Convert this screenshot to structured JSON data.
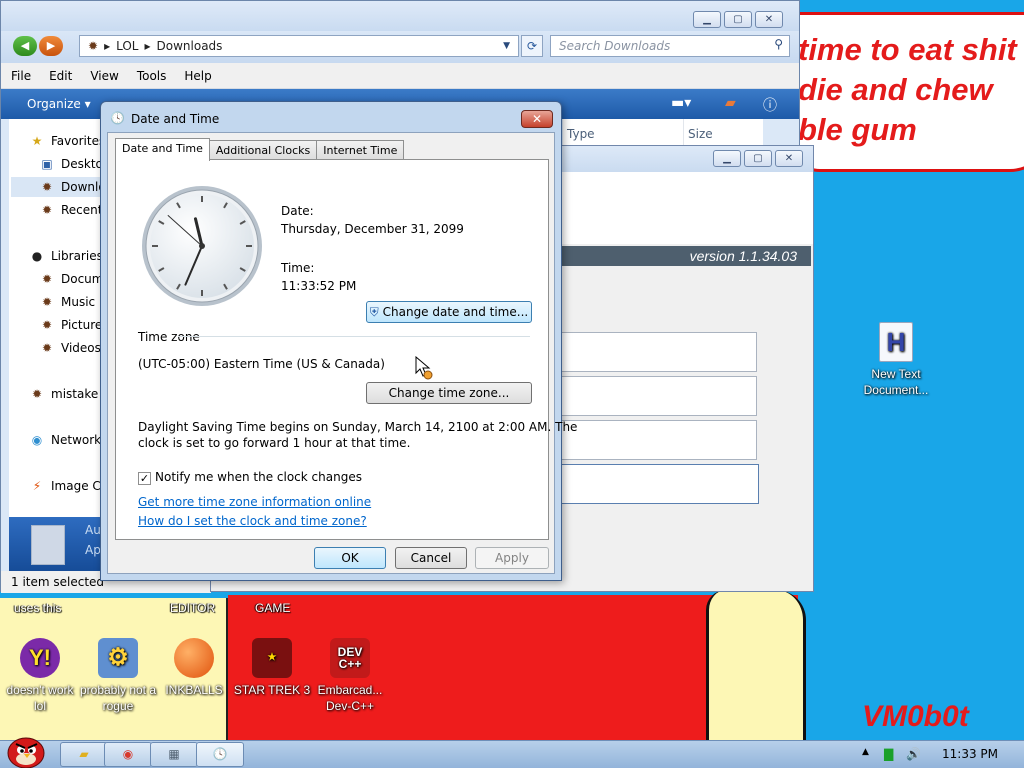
{
  "desktop": {
    "speech_text": "time to eat shit\ndie and chew\nble gum",
    "signature": "VM0b0t",
    "captions": [
      "uses this",
      "EDITOR",
      "GAME"
    ],
    "icons": [
      {
        "label": "doesn't work lol",
        "icon": "yahoo-messenger-icon"
      },
      {
        "label": "probably not a rogue",
        "icon": "system-settings-icon"
      },
      {
        "label": "INKBALLS",
        "icon": "inkball-icon"
      },
      {
        "label": "STAR TREK 3",
        "icon": "star-wars-game-icon"
      },
      {
        "label": "Embarcad... Dev-C++",
        "icon": "dev-cpp-icon"
      },
      {
        "label": "New Text Document...",
        "icon": "text-document-icon"
      }
    ]
  },
  "explorer": {
    "breadcrumb": [
      "LOL",
      "Downloads"
    ],
    "search_placeholder": "Search Downloads",
    "menu": [
      "File",
      "Edit",
      "View",
      "Tools",
      "Help"
    ],
    "organize_label": "Organize",
    "nav_items": [
      {
        "label": "Favorites",
        "icon": "star-icon"
      },
      {
        "label": "Deskto",
        "icon": "desktop-icon"
      },
      {
        "label": "Downlo",
        "icon": "downloads-icon"
      },
      {
        "label": "Recent",
        "icon": "recent-places-icon"
      },
      {
        "label": "Libraries",
        "icon": "libraries-icon"
      },
      {
        "label": "Docum",
        "icon": "documents-icon"
      },
      {
        "label": "Music",
        "icon": "music-icon"
      },
      {
        "label": "Pictures",
        "icon": "pictures-icon"
      },
      {
        "label": "Videos",
        "icon": "videos-icon"
      },
      {
        "label": "mistake",
        "icon": "homegroup-icon"
      },
      {
        "label": "Network",
        "icon": "network-icon"
      },
      {
        "label": "Image Ca",
        "icon": "image-capture-icon"
      }
    ],
    "columns": [
      "Type",
      "Size"
    ],
    "details_text": [
      "Au",
      "Ap"
    ],
    "status_text": "1 item selected"
  },
  "bgapp": {
    "version": "version 1.1.34.03"
  },
  "dialog": {
    "title": "Date and Time",
    "tabs": [
      "Date and Time",
      "Additional Clocks",
      "Internet Time"
    ],
    "date_label": "Date:",
    "date_value": "Thursday, December 31, 2099",
    "time_label": "Time:",
    "time_value": "11:33:52 PM",
    "change_datetime_button": "Change date and time...",
    "timezone_heading": "Time zone",
    "timezone_value": "(UTC-05:00) Eastern Time (US & Canada)",
    "change_timezone_button": "Change time zone...",
    "dst_text_line1": "Daylight Saving Time begins on Sunday, March 14, 2100 at 2:00 AM. The",
    "dst_text_line2": "clock is set to go forward 1 hour at that time.",
    "notify_label": "Notify me when the clock changes",
    "notify_checked": true,
    "link_more_info": "Get more time zone information online",
    "link_how_set": "How do I set the clock and time zone?",
    "ok_button": "OK",
    "cancel_button": "Cancel",
    "apply_button": "Apply"
  },
  "taskbar": {
    "clock": "11:33 PM",
    "buttons": [
      "explorer-icon",
      "chrome-icon",
      "calculator-icon",
      "date-time-icon"
    ]
  }
}
